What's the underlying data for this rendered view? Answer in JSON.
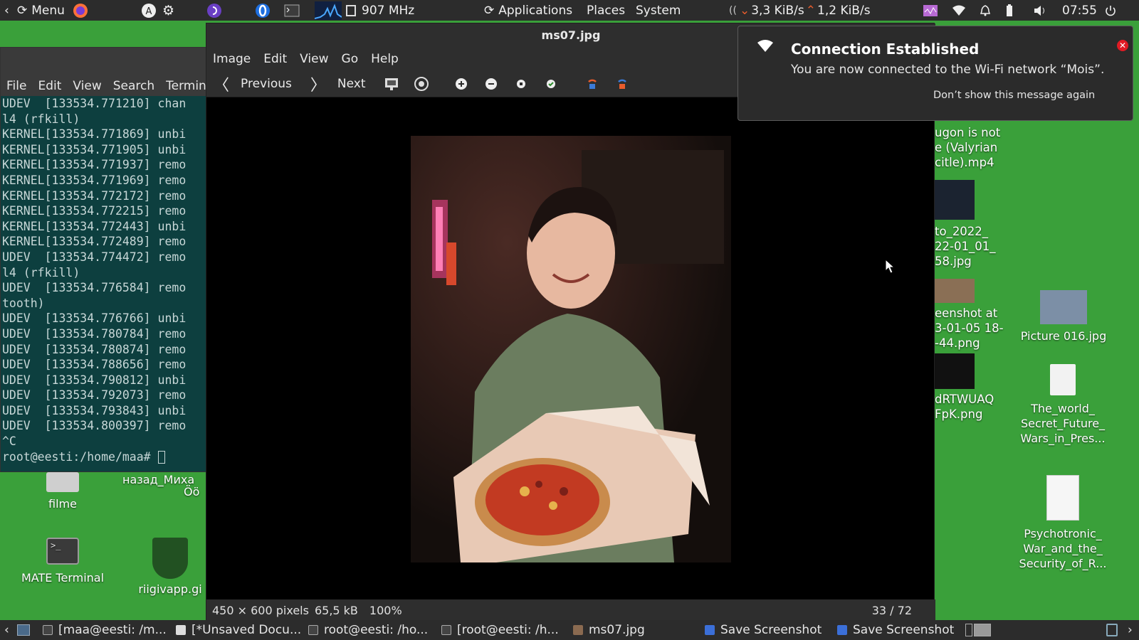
{
  "top_panel": {
    "menu_label": "Menu",
    "cpu_freq": "907 MHz",
    "applications": "Applications",
    "places": "Places",
    "system": "System",
    "net_down": "3,3 KiB/s",
    "net_up": "1,2 KiB/s",
    "clock": "07:55"
  },
  "desktop": {
    "icons_left": [
      {
        "label": "filme"
      },
      {
        "label": "MATE Terminal"
      },
      {
        "label": "riigivapp.gi"
      }
    ],
    "left_partial_label_1": "назад_Миха",
    "left_partial_label_2": "Öö",
    "icons_right": [
      {
        "label": "Picture 016.jpg"
      },
      {
        "label": "The_world_ Secret_Future_ Wars_in_Pres..."
      },
      {
        "label": "Psychotronic_ War_and_the_ Security_of_R..."
      }
    ],
    "behind_viewer_labels": [
      "ugon is not",
      "e (Valyrian",
      "citle).mp4",
      "to_2022_",
      "22-01_01_",
      "58.jpg",
      "eenshot at",
      "3-01-05 18-",
      "-44.png",
      "dRTWUAQ",
      "FpK.png"
    ]
  },
  "terminal": {
    "menu": [
      "File",
      "Edit",
      "View",
      "Search",
      "Termin"
    ],
    "lines": [
      "UDEV  [133534.771210] chan",
      "l4 (rfkill)",
      "KERNEL[133534.771869] unbi",
      "KERNEL[133534.771905] unbi",
      "KERNEL[133534.771937] remo",
      "KERNEL[133534.771969] remo",
      "KERNEL[133534.772172] remo",
      "KERNEL[133534.772215] remo",
      "KERNEL[133534.772443] unbi",
      "KERNEL[133534.772489] remo",
      "UDEV  [133534.774472] remo",
      "l4 (rfkill)",
      "UDEV  [133534.776584] remo",
      "tooth)",
      "UDEV  [133534.776766] unbi",
      "UDEV  [133534.780784] remo",
      "UDEV  [133534.780874] remo",
      "UDEV  [133534.788656] remo",
      "UDEV  [133534.790812] unbi",
      "UDEV  [133534.792073] remo",
      "UDEV  [133534.793843] unbi",
      "UDEV  [133534.800397] remo",
      "^C",
      "root@eesti:/home/maa# "
    ]
  },
  "viewer": {
    "title": "ms07.jpg",
    "menu": [
      "Image",
      "Edit",
      "View",
      "Go",
      "Help"
    ],
    "previous_label": "Previous",
    "next_label": "Next",
    "dimensions": "450 × 600 pixels",
    "size": "65,5 kB",
    "zoom": "100%",
    "position": "33 / 72"
  },
  "notification": {
    "title": "Connection Established",
    "body": "You are now connected to the Wi-Fi network “Mois”.",
    "dont_show": "Don’t show this message again"
  },
  "taskbar": {
    "tasks": [
      "[maa@eesti: /m...",
      "[*Unsaved Docu...",
      "root@eesti: /ho...",
      "[root@eesti: /h...",
      "ms07.jpg",
      "Save Screenshot",
      "Save Screenshot"
    ]
  },
  "colors": {
    "desktop": "#3aa03a",
    "panel": "#2c2c2c",
    "terminal_bg": "#0d3f3f",
    "accent_orange": "#e85c2c",
    "notif_close": "#e01b24"
  }
}
